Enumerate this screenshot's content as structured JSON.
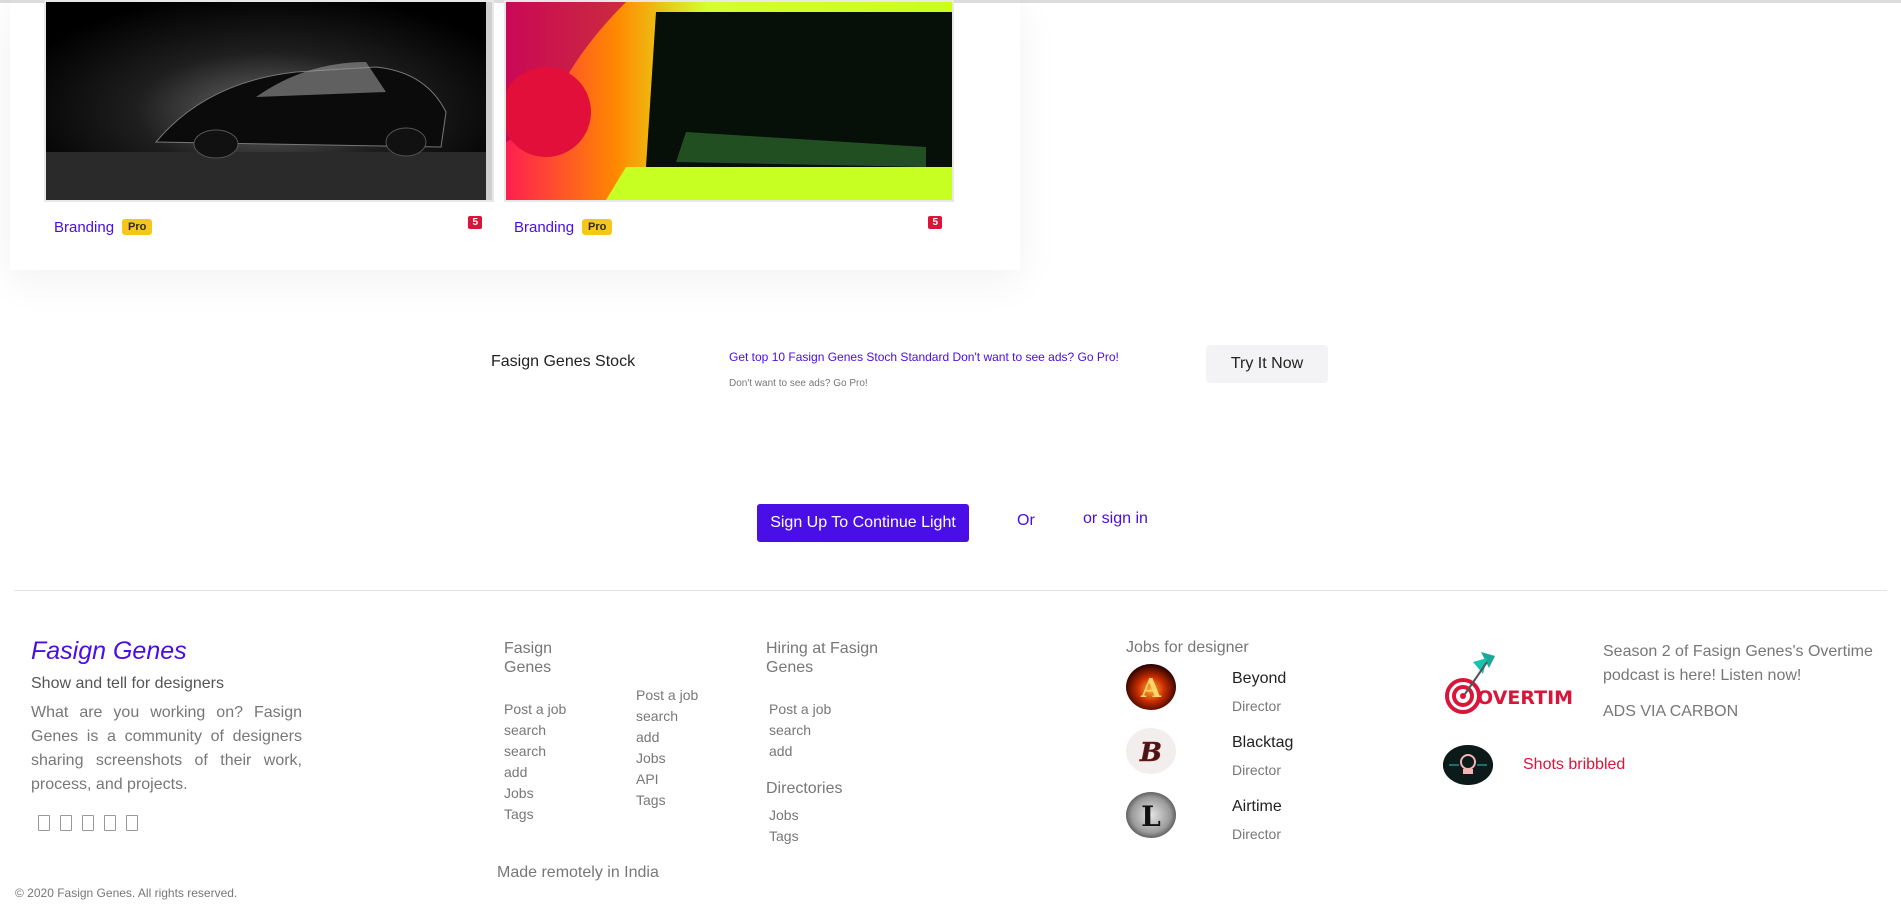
{
  "shots": [
    {
      "category": "Branding",
      "badge": "Pro",
      "count": "5"
    },
    {
      "category": "Branding",
      "badge": "Pro",
      "count": "5"
    }
  ],
  "ad": {
    "title": "Fasign Genes Stock",
    "link": "Get top 10 Fasign Genes Stoch Standard Don't want to see ads? Go Pro!",
    "sub": "Don't want to see ads? Go Pro!",
    "button": "Try It Now"
  },
  "signup": {
    "button": "Sign Up To Continue Light",
    "or": "Or",
    "signin": "or sign in"
  },
  "footer": {
    "brand": "Fasign Genes",
    "tagline": "Show and tell for designers",
    "about": "What are you working on? Fasign Genes is a community of designers sharing screenshots of their work, process, and projects.",
    "copyright": "© 2020 Fasign Genes. All rights reserved.",
    "made": "Made remotely in India",
    "col1_head": "Fasign Genes",
    "col1_links": [
      "Post a job",
      "search",
      "search",
      "add",
      "Jobs",
      "Tags"
    ],
    "col2_links": [
      "Post a job",
      "search",
      "add",
      "Jobs",
      "API",
      "Tags"
    ],
    "col3_head": "Hiring at Fasign Genes",
    "col3_links": [
      "Post a job",
      "search",
      "add"
    ],
    "col3_sub_head": "Directories",
    "col3_sub_links": [
      "Jobs",
      "Tags"
    ],
    "jobs_head": "Jobs for designer",
    "jobs": [
      {
        "name": "Beyond",
        "role": "Director",
        "letter": "A"
      },
      {
        "name": "Blacktag",
        "role": "Director",
        "letter": "B"
      },
      {
        "name": "Airtime",
        "role": "Director",
        "letter": "L"
      }
    ],
    "carbon_text": "Season 2 of Fasign Genes's Overtime podcast is here! Listen now!",
    "carbon_by": "ADS VIA CARBON",
    "carbon_logo_text": "OVERTIME",
    "shots_link": "Shots bribbled"
  },
  "colors": {
    "accent": "#4a0fe6",
    "badge_red": "#d9163a",
    "pro_yellow": "#f5c71a"
  }
}
